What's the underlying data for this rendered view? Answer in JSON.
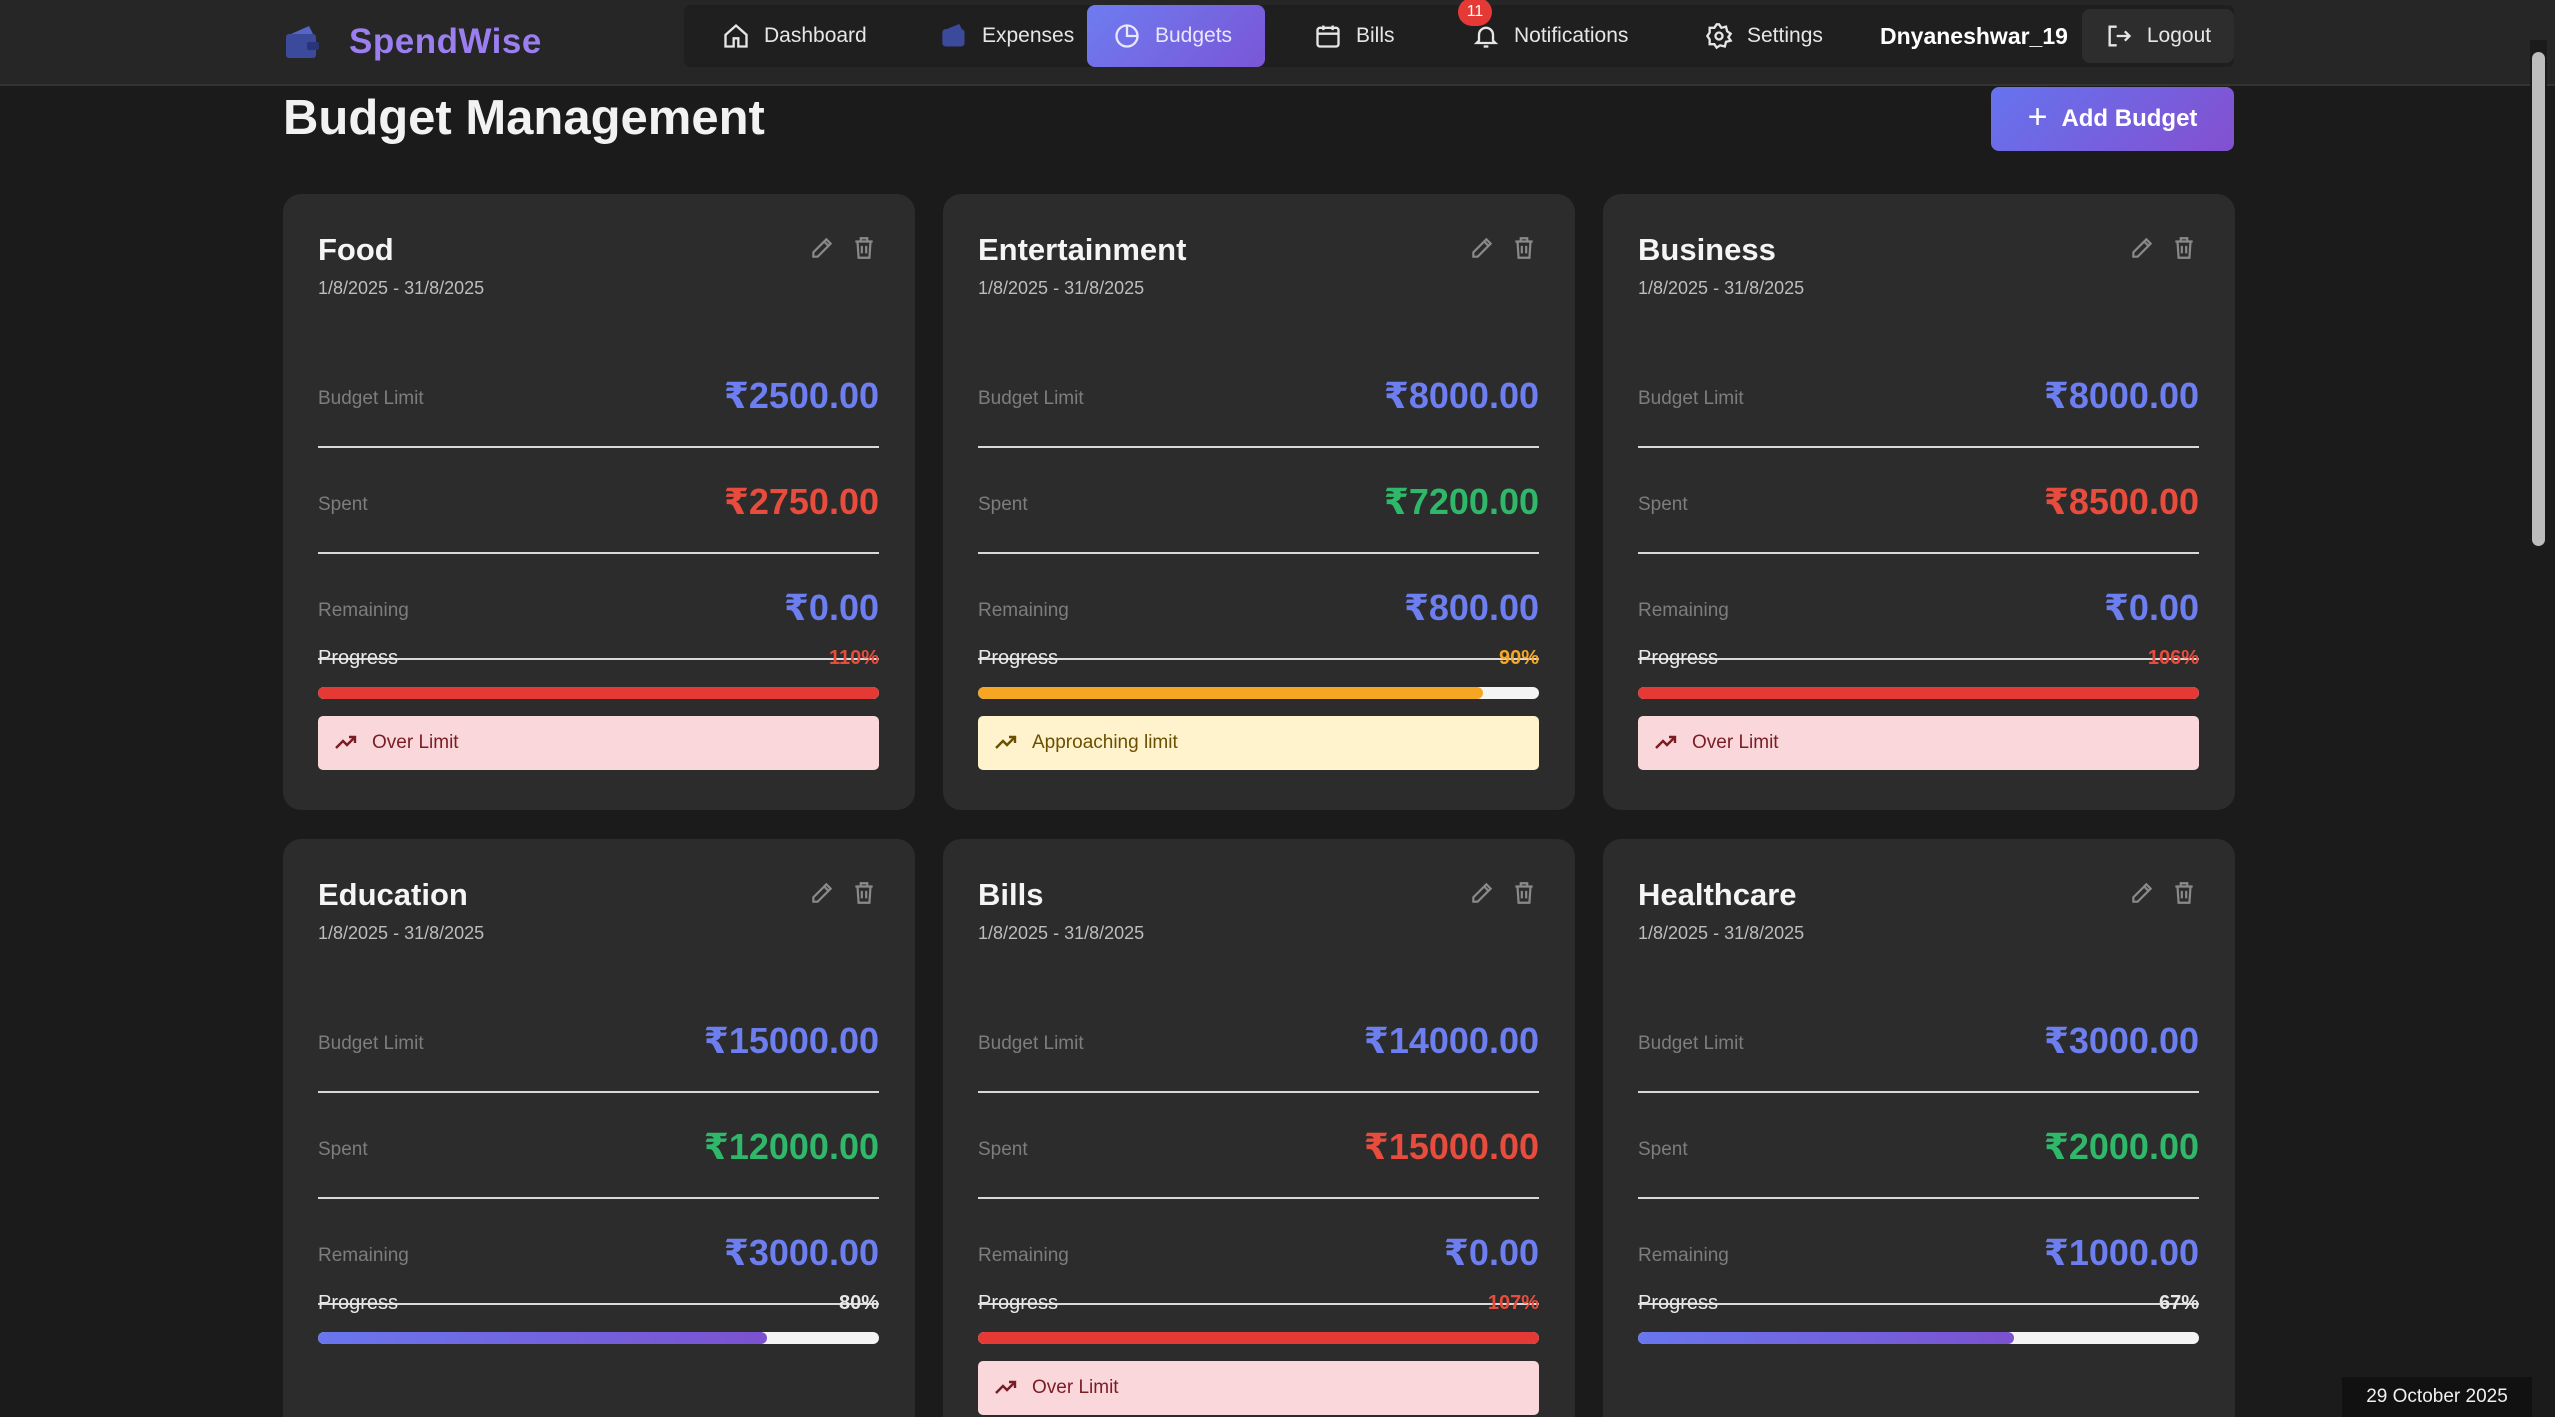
{
  "app": {
    "name": "SpendWise"
  },
  "nav": {
    "items": [
      {
        "label": "Dashboard",
        "icon": "home-icon"
      },
      {
        "label": "Expenses",
        "icon": "wallet-icon"
      },
      {
        "label": "Budgets",
        "icon": "pie-chart-icon",
        "active": true
      },
      {
        "label": "Bills",
        "icon": "calendar-icon"
      },
      {
        "label": "Notifications",
        "icon": "bell-icon",
        "badge": "11"
      },
      {
        "label": "Settings",
        "icon": "gear-icon"
      }
    ],
    "username": "Dnyaneshwar_19",
    "logout_label": "Logout"
  },
  "page": {
    "title": "Budget Management",
    "add_button_label": "Add Budget"
  },
  "labels": {
    "limit": "Budget Limit",
    "spent": "Spent",
    "remaining": "Remaining",
    "progress": "Progress"
  },
  "budgets": [
    {
      "name": "Food",
      "dates": "1/8/2025 - 31/8/2025",
      "limit": "₹2500.00",
      "spent": "₹2750.00",
      "remaining": "₹0.00",
      "percent": "110%",
      "progress_fraction": 1.0,
      "status": "Over Limit"
    },
    {
      "name": "Entertainment",
      "dates": "1/8/2025 - 31/8/2025",
      "limit": "₹8000.00",
      "spent": "₹7200.00",
      "remaining": "₹800.00",
      "percent": "90%",
      "progress_fraction": 0.9,
      "status": "Approaching limit"
    },
    {
      "name": "Business",
      "dates": "1/8/2025 - 31/8/2025",
      "limit": "₹8000.00",
      "spent": "₹8500.00",
      "remaining": "₹0.00",
      "percent": "106%",
      "progress_fraction": 1.0,
      "status": "Over Limit"
    },
    {
      "name": "Education",
      "dates": "1/8/2025 - 31/8/2025",
      "limit": "₹15000.00",
      "spent": "₹12000.00",
      "remaining": "₹3000.00",
      "percent": "80%",
      "progress_fraction": 0.8,
      "status": ""
    },
    {
      "name": "Bills",
      "dates": "1/8/2025 - 31/8/2025",
      "limit": "₹14000.00",
      "spent": "₹15000.00",
      "remaining": "₹0.00",
      "percent": "107%",
      "progress_fraction": 1.0,
      "status": "Over Limit"
    },
    {
      "name": "Healthcare",
      "dates": "1/8/2025 - 31/8/2025",
      "limit": "₹3000.00",
      "spent": "₹2000.00",
      "remaining": "₹1000.00",
      "percent": "67%",
      "progress_fraction": 0.67,
      "status": ""
    }
  ],
  "colors": {
    "accent": "#6d7ff0",
    "over": "#e74c3c",
    "ok": "#2fb86a",
    "warn": "#f5a623"
  },
  "footer": {
    "date": "29 October 2025"
  }
}
